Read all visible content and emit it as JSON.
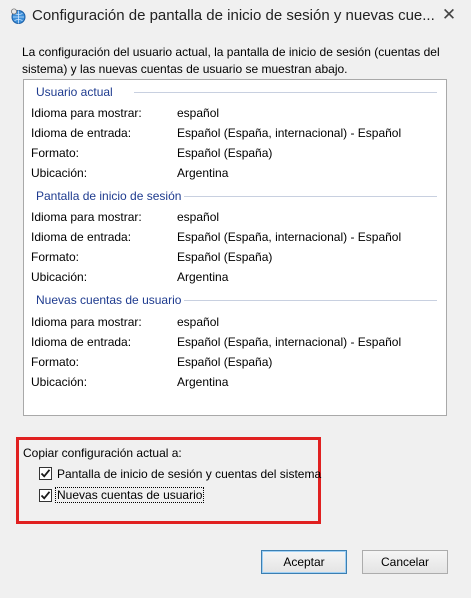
{
  "window": {
    "title": "Configuración de pantalla de inicio de sesión y nuevas cue...",
    "close_symbol": "✕"
  },
  "description": "La configuración del usuario actual, la pantalla de inicio de sesión (cuentas del sistema) y las nuevas cuentas de usuario se muestran abajo.",
  "sections": [
    {
      "heading": "Usuario actual",
      "rows": [
        {
          "label": "Idioma para mostrar:",
          "value": "español"
        },
        {
          "label": "Idioma de entrada:",
          "value": "Español (España, internacional) - Español"
        },
        {
          "label": "Formato:",
          "value": "Español (España)"
        },
        {
          "label": "Ubicación:",
          "value": "Argentina"
        }
      ]
    },
    {
      "heading": "Pantalla de inicio de sesión",
      "rows": [
        {
          "label": "Idioma para mostrar:",
          "value": "español"
        },
        {
          "label": "Idioma de entrada:",
          "value": "Español (España, internacional) - Español"
        },
        {
          "label": "Formato:",
          "value": "Español (España)"
        },
        {
          "label": "Ubicación:",
          "value": "Argentina"
        }
      ]
    },
    {
      "heading": "Nuevas cuentas de usuario",
      "rows": [
        {
          "label": "Idioma para mostrar:",
          "value": "español"
        },
        {
          "label": "Idioma de entrada:",
          "value": "Español (España, internacional) - Español"
        },
        {
          "label": "Formato:",
          "value": "Español (España)"
        },
        {
          "label": "Ubicación:",
          "value": "Argentina"
        }
      ]
    }
  ],
  "copy": {
    "label": "Copiar configuración actual a:",
    "options": [
      {
        "label": "Pantalla de inicio de sesión y cuentas del sistema",
        "checked": true
      },
      {
        "label": "Nuevas cuentas de usuario",
        "checked": true
      }
    ]
  },
  "buttons": {
    "ok": "Aceptar",
    "cancel": "Cancelar"
  },
  "colors": {
    "highlight_border": "#e02020",
    "section_heading": "#1e3b8f"
  },
  "icons": {
    "title": "globe-settings-icon",
    "check": "checkmark-icon"
  }
}
